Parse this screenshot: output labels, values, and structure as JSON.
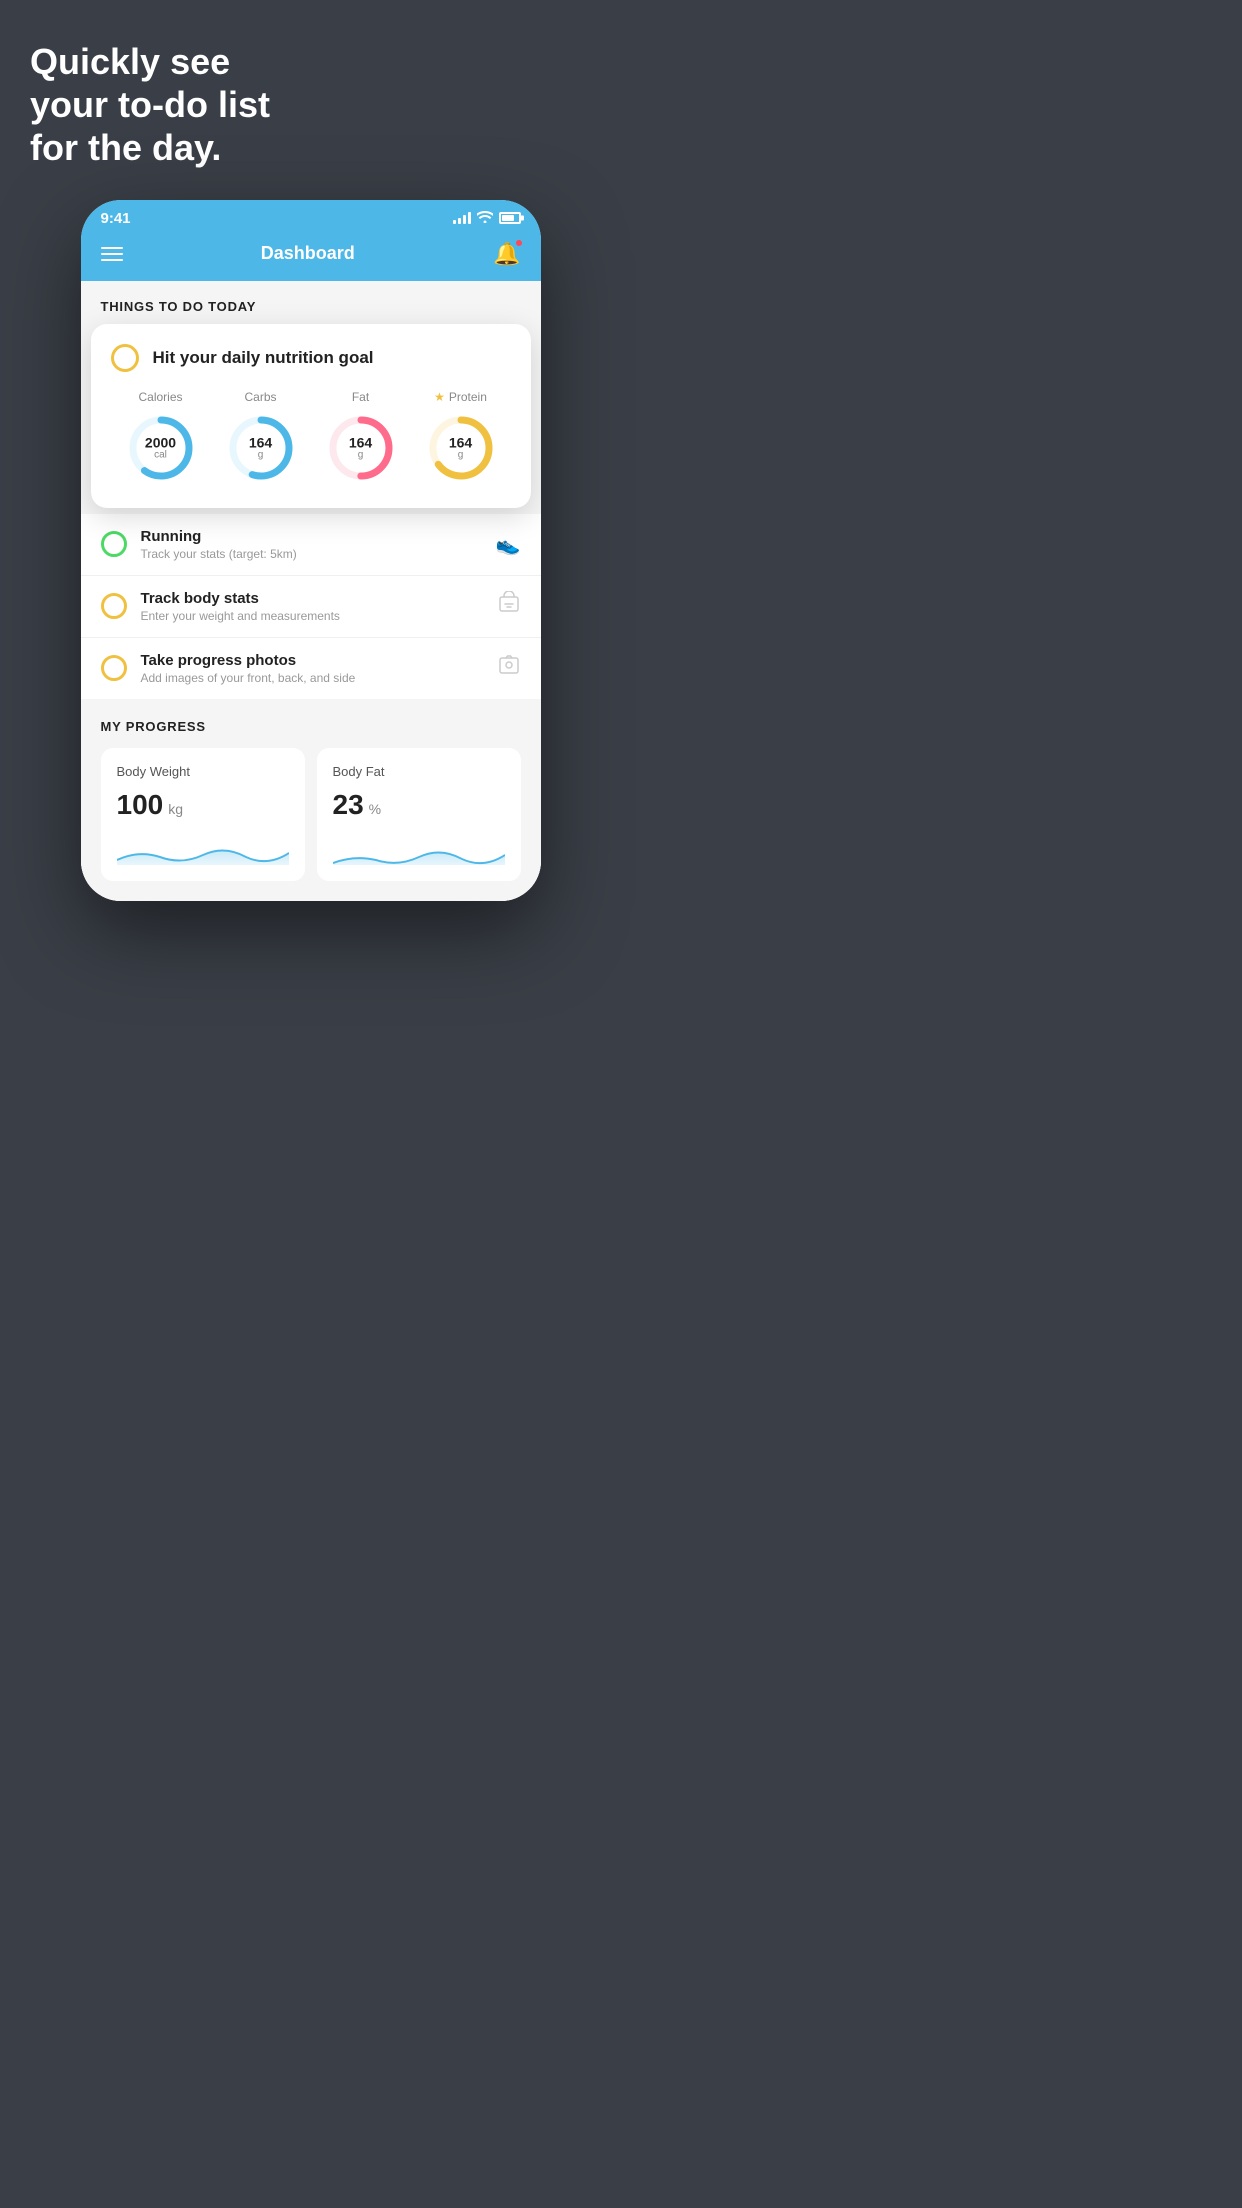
{
  "hero": {
    "title": "Quickly see\nyour to-do list\nfor the day."
  },
  "statusBar": {
    "time": "9:41",
    "signal": "signal",
    "wifi": "wifi",
    "battery": "battery"
  },
  "navBar": {
    "title": "Dashboard"
  },
  "thingsToDoSection": {
    "heading": "THINGS TO DO TODAY"
  },
  "nutritionCard": {
    "title": "Hit your daily nutrition goal",
    "items": [
      {
        "label": "Calories",
        "value": "2000",
        "unit": "cal",
        "color": "#4db8e8",
        "percent": 60,
        "hasStar": false
      },
      {
        "label": "Carbs",
        "value": "164",
        "unit": "g",
        "color": "#4db8e8",
        "percent": 55,
        "hasStar": false
      },
      {
        "label": "Fat",
        "value": "164",
        "unit": "g",
        "color": "#ff6b8a",
        "percent": 50,
        "hasStar": false
      },
      {
        "label": "Protein",
        "value": "164",
        "unit": "g",
        "color": "#f0c040",
        "percent": 65,
        "hasStar": true
      }
    ]
  },
  "todoItems": [
    {
      "title": "Running",
      "subtitle": "Track your stats (target: 5km)",
      "circleColor": "green",
      "iconType": "shoe"
    },
    {
      "title": "Track body stats",
      "subtitle": "Enter your weight and measurements",
      "circleColor": "yellow",
      "iconType": "scale"
    },
    {
      "title": "Take progress photos",
      "subtitle": "Add images of your front, back, and side",
      "circleColor": "yellow",
      "iconType": "photo"
    }
  ],
  "progressSection": {
    "heading": "MY PROGRESS",
    "cards": [
      {
        "title": "Body Weight",
        "value": "100",
        "unit": "kg"
      },
      {
        "title": "Body Fat",
        "value": "23",
        "unit": "%"
      }
    ]
  }
}
